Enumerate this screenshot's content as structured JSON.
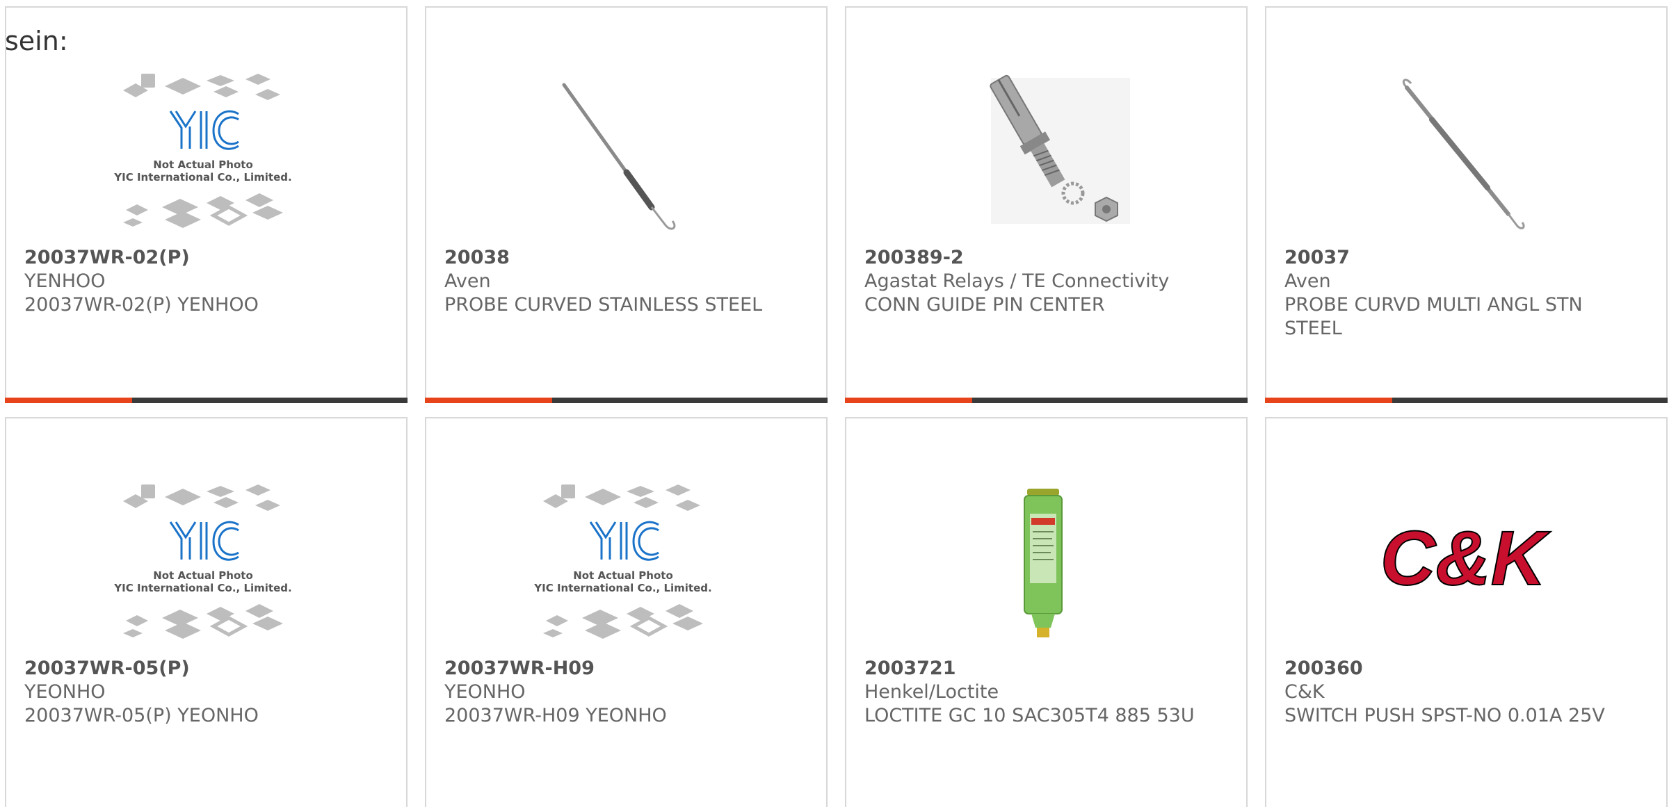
{
  "lead_text": "sein:",
  "colors": {
    "accent": "#e8441b",
    "bar": "#3a3a3a",
    "card_border": "#d8d8d8",
    "text": "#666666",
    "yic_blue": "#1a73c9",
    "ck_red": "#c8102e"
  },
  "placeholder_photo": {
    "line1": "Not Actual Photo",
    "line2": "YIC International Co., Limited.",
    "logo": "YIC"
  },
  "products": [
    {
      "part_number": "20037WR-02(P)",
      "maker": "YENHOO",
      "description": "20037WR-02(P) YENHOO",
      "image": "yic-placeholder-image"
    },
    {
      "part_number": "20038",
      "maker": "Aven",
      "description": "PROBE CURVED STAINLESS STEEL",
      "image": "probe-tool-image"
    },
    {
      "part_number": "200389-2",
      "maker": "Agastat Relays / TE Connectivity",
      "description": "CONN GUIDE PIN CENTER",
      "image": "guide-pin-image"
    },
    {
      "part_number": "20037",
      "maker": "Aven",
      "description": "PROBE CURVD MULTI ANGL STN STEEL",
      "image": "double-probe-image"
    },
    {
      "part_number": "20037WR-05(P)",
      "maker": "YEONHO",
      "description": "20037WR-05(P) YEONHO",
      "image": "yic-placeholder-image"
    },
    {
      "part_number": "20037WR-H09",
      "maker": "YEONHO",
      "description": "20037WR-H09 YEONHO",
      "image": "yic-placeholder-image"
    },
    {
      "part_number": "2003721",
      "maker": "Henkel/Loctite",
      "description": "LOCTITE GC 10 SAC305T4 885 53U",
      "image": "solder-paste-cartridge-image"
    },
    {
      "part_number": "200360",
      "maker": "C&K",
      "description": "SWITCH PUSH SPST-NO 0.01A 25V",
      "image": "ck-logo",
      "logo_text": "C&K"
    }
  ]
}
